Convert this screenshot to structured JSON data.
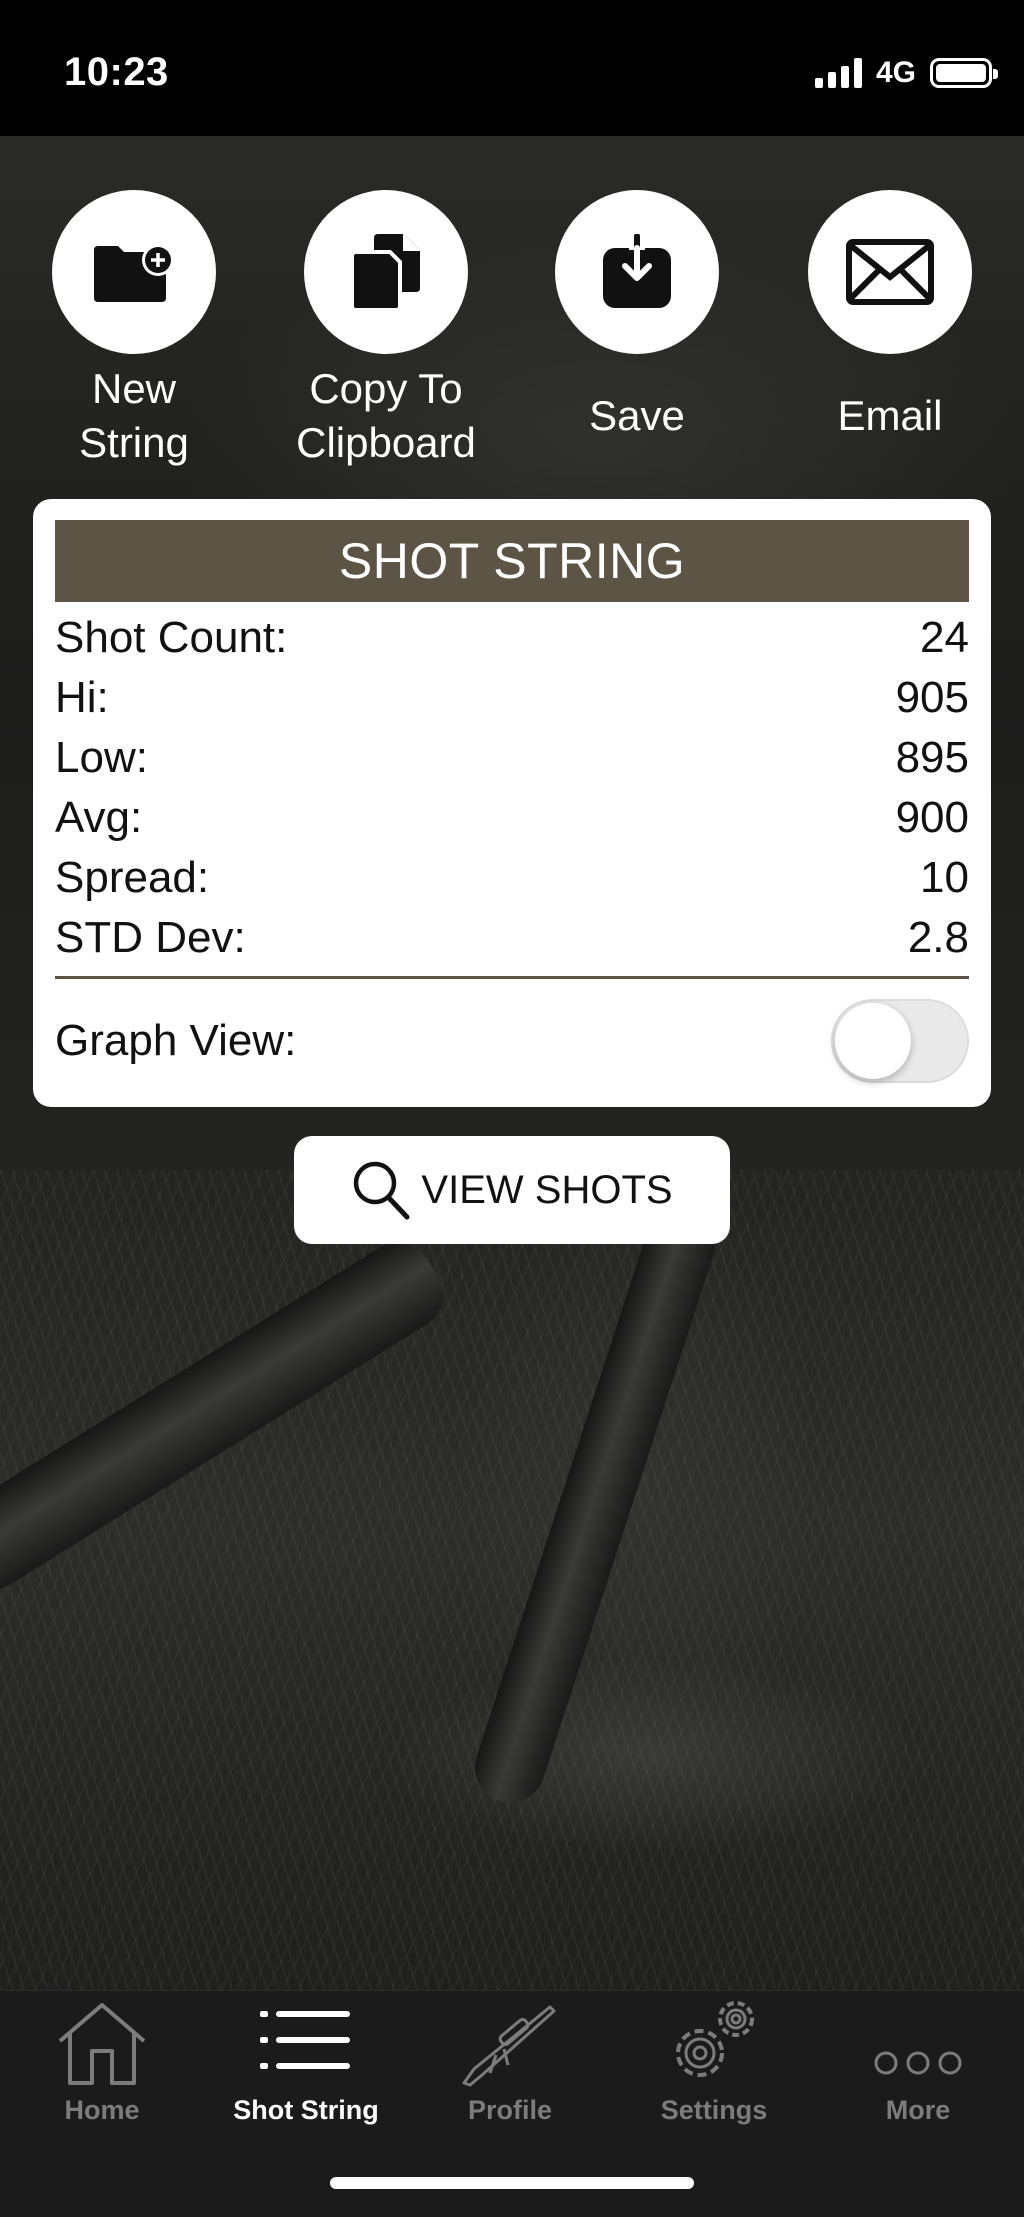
{
  "status_bar": {
    "time": "10:23",
    "network": "4G",
    "battery_level": 1.0
  },
  "actions": [
    {
      "label": "New\nString",
      "icon": "folder-plus-icon"
    },
    {
      "label": "Copy To\nClipboard",
      "icon": "copy-icon"
    },
    {
      "label": "Save",
      "icon": "download-icon"
    },
    {
      "label": "Email",
      "icon": "envelope-icon"
    }
  ],
  "card": {
    "header": "SHOT STRING",
    "stats": [
      {
        "label": "Shot Count:",
        "value": "24"
      },
      {
        "label": "Hi:",
        "value": "905"
      },
      {
        "label": "Low:",
        "value": "895"
      },
      {
        "label": "Avg:",
        "value": "900"
      },
      {
        "label": "Spread:",
        "value": "10"
      },
      {
        "label": "STD Dev:",
        "value": "2.8"
      }
    ],
    "graph_view_label": "Graph View:",
    "graph_view_enabled": false,
    "accent_color": "#5c5444"
  },
  "view_shots_button": {
    "label": "VIEW SHOTS",
    "icon": "search-icon"
  },
  "tab_bar": {
    "active_index": 1,
    "tabs": [
      {
        "label": "Home",
        "icon": "home-icon"
      },
      {
        "label": "Shot String",
        "icon": "menu-lines-icon"
      },
      {
        "label": "Profile",
        "icon": "rifle-icon"
      },
      {
        "label": "Settings",
        "icon": "gears-icon"
      },
      {
        "label": "More",
        "icon": "more-dots-icon"
      }
    ]
  }
}
